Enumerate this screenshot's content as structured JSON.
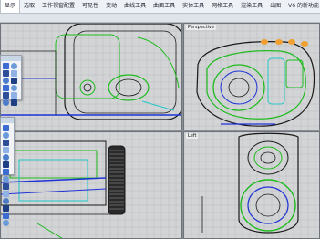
{
  "menu": {
    "tabs": [
      "显示",
      "选取",
      "工作视窗配置",
      "可见性",
      "变动",
      "曲线工具",
      "曲面工具",
      "实体工具",
      "网格工具",
      "渲染工具",
      "出图",
      "V6 的新功能"
    ],
    "active_tab": 0
  },
  "viewports": {
    "top_left": "",
    "perspective": "Perspective",
    "front": "",
    "left": "Left"
  },
  "colors": {
    "viewport_bg": "#d3d4d6",
    "grid_line": "#b9bbbe",
    "wire_dark": "#1a1a1a",
    "wire_green": "#1dbb1d",
    "wire_blue": "#1e33d6",
    "wire_cyan": "#22c7c7",
    "selection_blue": "#3c6bd1"
  },
  "palettes": [
    {
      "name": "left-tool-palette-upper",
      "icons": [
        "select-icon",
        "point-icon",
        "curve-icon",
        "surface-icon",
        "solid-icon",
        "mesh-icon",
        "transform-icon",
        "dimension-icon",
        "analyze-icon",
        "render-icon",
        "group-icon",
        "layer-icon"
      ]
    },
    {
      "name": "left-tool-palette-lower",
      "icons": [
        "box-icon",
        "sphere-icon",
        "cylinder-icon",
        "cone-icon",
        "torus-icon",
        "extrude-icon",
        "boolean-icon",
        "fillet-icon",
        "shell-icon",
        "cap-icon",
        "split-icon",
        "join-icon",
        "explode-icon",
        "rebuild-icon"
      ]
    }
  ]
}
